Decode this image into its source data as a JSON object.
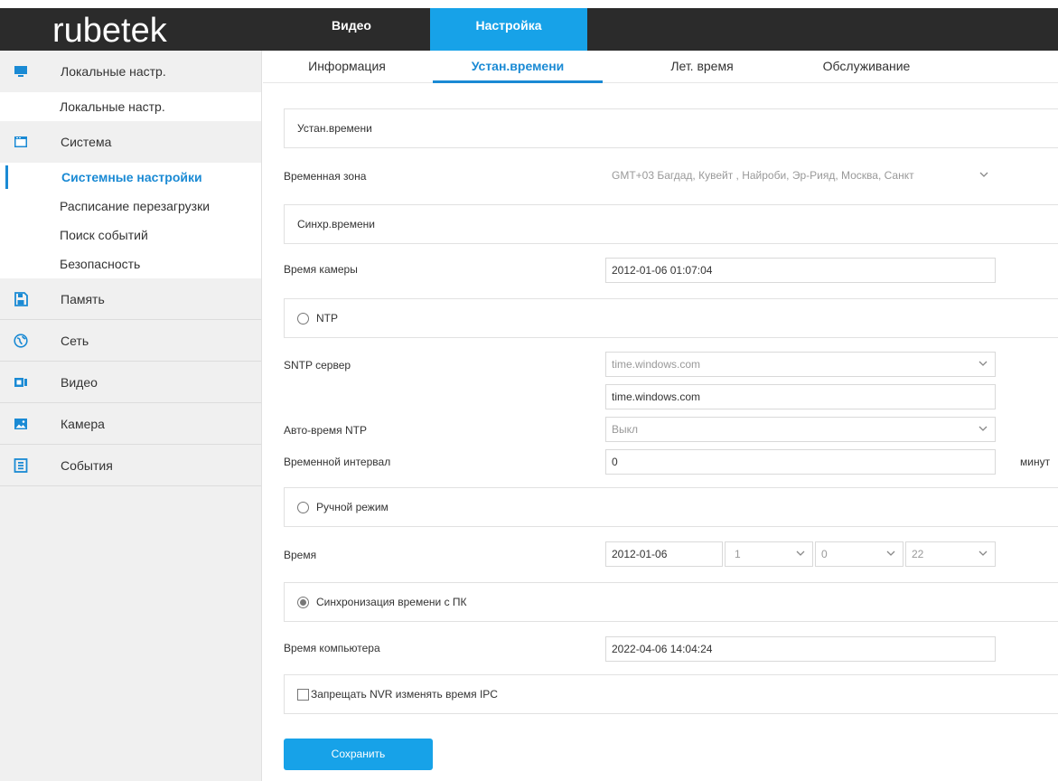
{
  "brand": {
    "logo_text": "rubetek"
  },
  "top_nav": {
    "video": "Видео",
    "settings": "Настройка"
  },
  "sidebar": {
    "groups": [
      {
        "label": "Локальные настр.",
        "icon": "monitor-icon"
      },
      {
        "label": "Система",
        "icon": "system-icon"
      },
      {
        "label": "Память",
        "icon": "floppy-icon"
      },
      {
        "label": "Сеть",
        "icon": "globe-icon"
      },
      {
        "label": "Видео",
        "icon": "video-icon"
      },
      {
        "label": "Камера",
        "icon": "image-icon"
      },
      {
        "label": "События",
        "icon": "events-icon"
      }
    ],
    "local_sub": [
      "Локальные настр."
    ],
    "system_sub": [
      "Системные настройки",
      "Расписание перезагрузки",
      "Поиск событий",
      "Безопасность"
    ],
    "accent": "#1a8ad4"
  },
  "subtabs": [
    "Информация",
    "Устан.времени",
    "Лет. время",
    "Обслуживание"
  ],
  "form": {
    "section_time": "Устан.времени",
    "timezone_label": "Временная зона",
    "timezone_value": "GMT+03 Багдад, Кувейт , Найроби, Эр-Рияд, Москва, Санкт",
    "section_sync": "Синхр.времени",
    "camera_time_label": "Время камеры",
    "camera_time_value": "2012-01-06 01:07:04",
    "ntp_label": "NTP",
    "sntp_label": "SNTP сервер",
    "sntp_select": "time.windows.com",
    "sntp_input": "time.windows.com",
    "auto_ntp_label": "Авто-время NTP",
    "auto_ntp_value": "Выкл",
    "interval_label": "Временной интервал",
    "interval_value": "0",
    "interval_unit": "минут",
    "manual_label": "Ручной режим",
    "time_label": "Время",
    "time_date": "2012-01-06",
    "time_hour": "1",
    "time_min": "0",
    "time_sec": "22",
    "pc_sync_label": "Синхронизация времени с ПК",
    "pc_time_label": "Время компьютера",
    "pc_time_value": "2022-04-06 14:04:24",
    "nvr_label": "Запрещать NVR изменять время IPC",
    "save_label": "Сохранить"
  },
  "colors": {
    "accent": "#17a2e8",
    "topbar": "#2b2b2b"
  }
}
